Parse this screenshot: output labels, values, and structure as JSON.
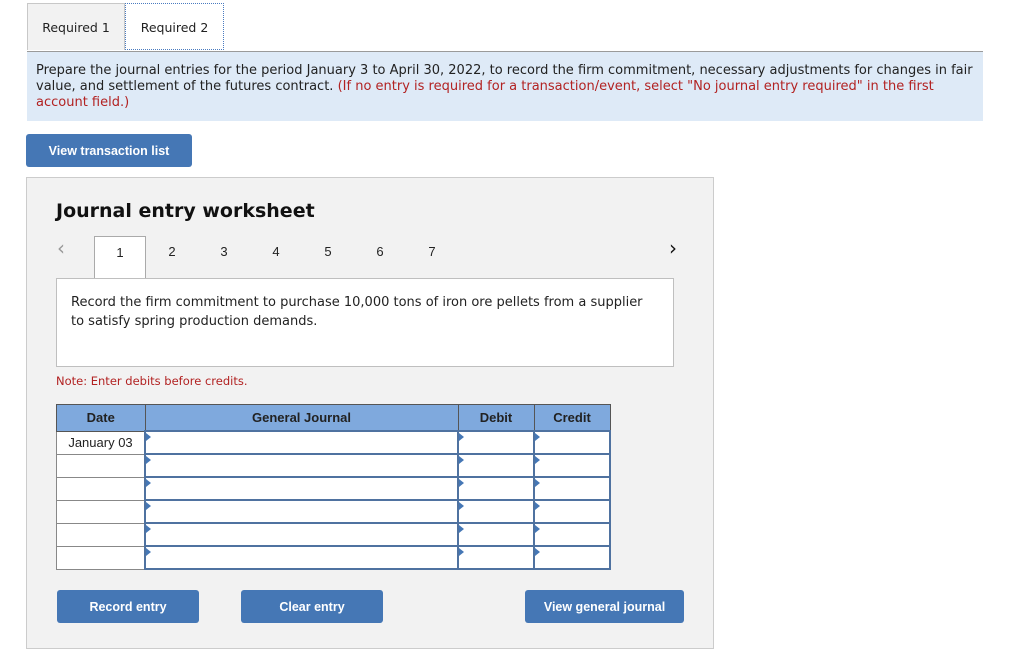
{
  "tabs": [
    {
      "label": "Required 1",
      "active": false
    },
    {
      "label": "Required 2",
      "active": true
    }
  ],
  "instructions": {
    "text": "Prepare the journal entries for the period January 3 to April 30, 2022, to record the firm commitment, necessary adjustments for changes in fair value, and settlement of the futures contract.",
    "note": "(If no entry is required for a transaction/event, select \"No journal entry required\" in the first account field.)"
  },
  "buttons": {
    "view_transaction_list": "View transaction list",
    "record_entry": "Record entry",
    "clear_entry": "Clear entry",
    "view_general_journal": "View general journal"
  },
  "worksheet": {
    "title": "Journal entry worksheet",
    "prev_icon": "chevron-left-icon",
    "next_icon": "chevron-right-icon",
    "pages": [
      "1",
      "2",
      "3",
      "4",
      "5",
      "6",
      "7"
    ],
    "active_page": "1",
    "description": "Record the firm commitment to purchase 10,000 tons of iron ore pellets from a supplier to satisfy spring production demands.",
    "note": "Note: Enter debits before credits."
  },
  "journal": {
    "headers": {
      "date": "Date",
      "account": "General Journal",
      "debit": "Debit",
      "credit": "Credit"
    },
    "rows": [
      {
        "date": "January 03",
        "account": "",
        "debit": "",
        "credit": ""
      },
      {
        "date": "",
        "account": "",
        "debit": "",
        "credit": ""
      },
      {
        "date": "",
        "account": "",
        "debit": "",
        "credit": ""
      },
      {
        "date": "",
        "account": "",
        "debit": "",
        "credit": ""
      },
      {
        "date": "",
        "account": "",
        "debit": "",
        "credit": ""
      },
      {
        "date": "",
        "account": "",
        "debit": "",
        "credit": ""
      }
    ]
  },
  "colors": {
    "button_blue": "#4577b5",
    "header_blue": "#7fa9dd",
    "instruction_bg": "#deeaf7",
    "note_red": "#b22222"
  }
}
